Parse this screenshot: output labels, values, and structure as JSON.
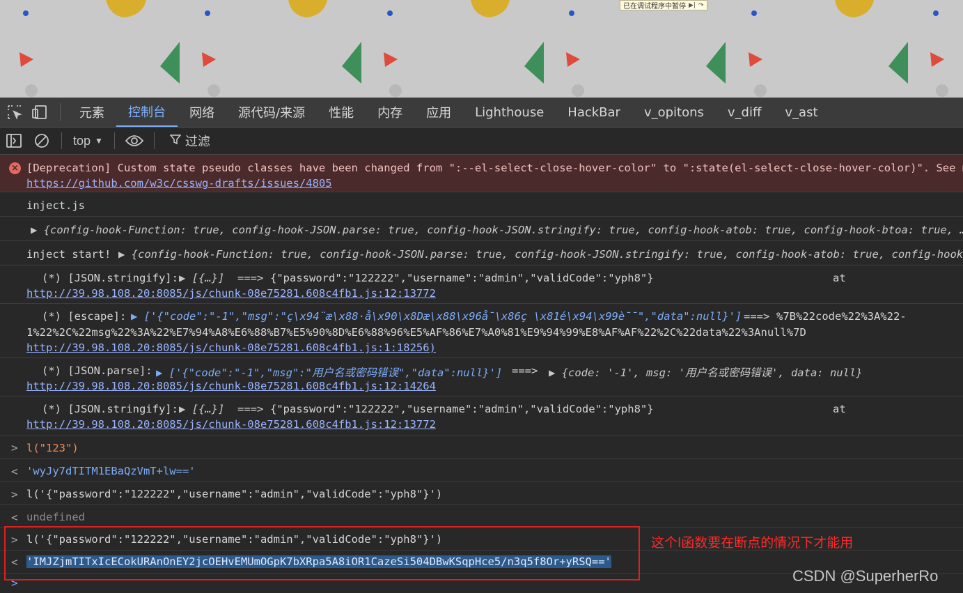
{
  "paused_banner": {
    "text": "已在调试程序中暂停",
    "resume_icon": "resume-icon",
    "step_icon": "step-over-icon"
  },
  "tabs": [
    {
      "label": "元素"
    },
    {
      "label": "控制台"
    },
    {
      "label": "网络"
    },
    {
      "label": "源代码/来源"
    },
    {
      "label": "性能"
    },
    {
      "label": "内存"
    },
    {
      "label": "应用"
    },
    {
      "label": "Lighthouse"
    },
    {
      "label": "HackBar"
    },
    {
      "label": "v_opitons"
    },
    {
      "label": "v_diff"
    },
    {
      "label": "v_ast"
    }
  ],
  "active_tab": "控制台",
  "toolbar": {
    "context": "top",
    "filter_label": "过滤"
  },
  "console": {
    "deprecation": {
      "text": "[Deprecation] Custom state pseudo classes have been changed from \":--el-select-close-hover-color\" to \":state(el-select-close-hover-color)\". See more",
      "link": "https://github.com/w3c/csswg-drafts/issues/4805"
    },
    "inject_js": "inject.js",
    "config_obj": "▶ {config-hook-Function: true, config-hook-JSON.parse: true, config-hook-JSON.stringify: true, config-hook-atob: true, config-hook-btoa: true, …}",
    "inject_start_label": "inject start!",
    "inject_start_obj": "▶ {config-hook-Function: true, config-hook-JSON.parse: true, config-hook-JSON.stringify: true, config-hook-atob: true, config-hook-btoa",
    "log1": {
      "prefix": "(*) [JSON.stringify]:",
      "arg": "▶ [{…}]",
      "arrow": "===>",
      "result": "{\"password\":\"122222\",\"username\":\"admin\",\"validCode\":\"yph8\"}",
      "at": "at",
      "link": "http://39.98.108.20:8085/js/chunk-08e75281.608c4fb1.js:12:13772"
    },
    "log2": {
      "prefix": "(*) [escape]:",
      "arg": "▶ ['{\"code\":\"-1\",\"msg\":\"ç\\x94¨æ\\x88·å\\x90\\x8Dæ\\x88\\x96å¯\\x86ç   \\x81é\\x94\\x99è¯¯\",\"data\":null}']",
      "arrow": "===>",
      "result1": "%7B%22code%22%3A%22-",
      "result2": "1%22%2C%22msg%22%3A%22%E7%94%A8%E6%88%B7%E5%90%8D%E6%88%96%E5%AF%86%E7%A0%81%E9%94%99%E8%AF%AF%22%2C%22data%22%3Anull%7D",
      "link": "http://39.98.108.20:8085/js/chunk-08e75281.608c4fb1.js:1:18256)"
    },
    "log3": {
      "prefix": "(*) [JSON.parse]:",
      "arg": "▶ ['{\"code\":\"-1\",\"msg\":\"用户名或密码错误\",\"data\":null}']",
      "arrow": "===>",
      "result": "▶ {code: '-1', msg: '用户名或密码错误', data: null}",
      "link": "http://39.98.108.20:8085/js/chunk-08e75281.608c4fb1.js:12:14264"
    },
    "log4": {
      "prefix": "(*) [JSON.stringify]:",
      "arg": "▶ [{…}]",
      "arrow": "===>",
      "result": "{\"password\":\"122222\",\"username\":\"admin\",\"validCode\":\"yph8\"}",
      "at": "at",
      "link": "http://39.98.108.20:8085/js/chunk-08e75281.608c4fb1.js:12:13772"
    },
    "input1": "l(\"123\")",
    "output1": "'wyJy7dTITM1EBaQzVmT+lw=='",
    "input2": "l('{\"password\":\"122222\",\"username\":\"admin\",\"validCode\":\"yph8\"}')",
    "output2": "undefined",
    "input3": "l('{\"password\":\"122222\",\"username\":\"admin\",\"validCode\":\"yph8\"}')",
    "output3": "'IMJZjmTITxIcECokURAnOnEY2jcOEHvEMUmOGpK7bXRpa5A8iOR1CazeSi504DBwKSqpHce5/n3q5f8Or+yRSQ=='"
  },
  "annotation": "这个l函数要在断点的情况下才能用",
  "watermark": "CSDN @SuperherRo"
}
